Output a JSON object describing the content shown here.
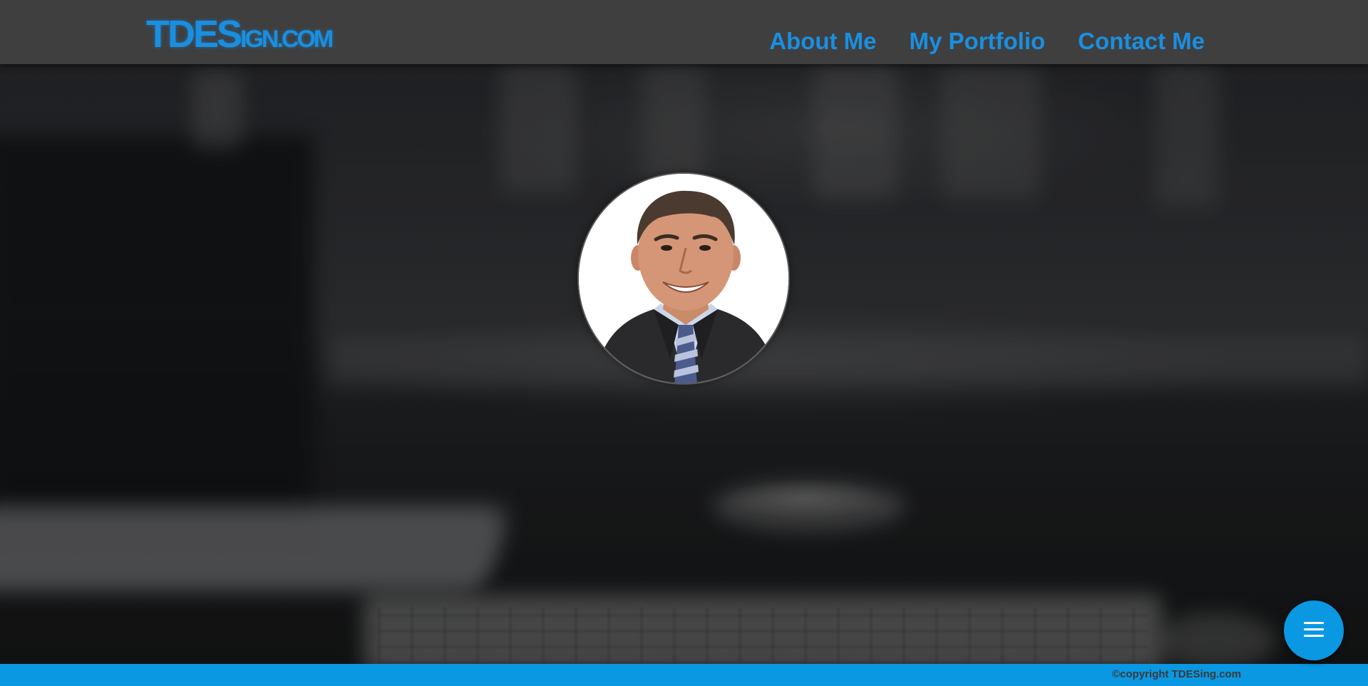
{
  "header": {
    "logo": {
      "big": "TDES",
      "small": "IGN.COM"
    },
    "nav": [
      {
        "label": "About Me"
      },
      {
        "label": "My Portfolio"
      },
      {
        "label": "Contact Me"
      }
    ]
  },
  "hero": {
    "avatar_icon": "profile-photo"
  },
  "footer": {
    "copyright": "©copyright TDESing.com"
  },
  "fab": {
    "icon": "hamburger-menu-icon"
  },
  "colors": {
    "accent": "#0a98e2",
    "link": "#1a8fe0",
    "header_bg": "#3f3f3f",
    "copyright_text": "#3a3a3a"
  }
}
